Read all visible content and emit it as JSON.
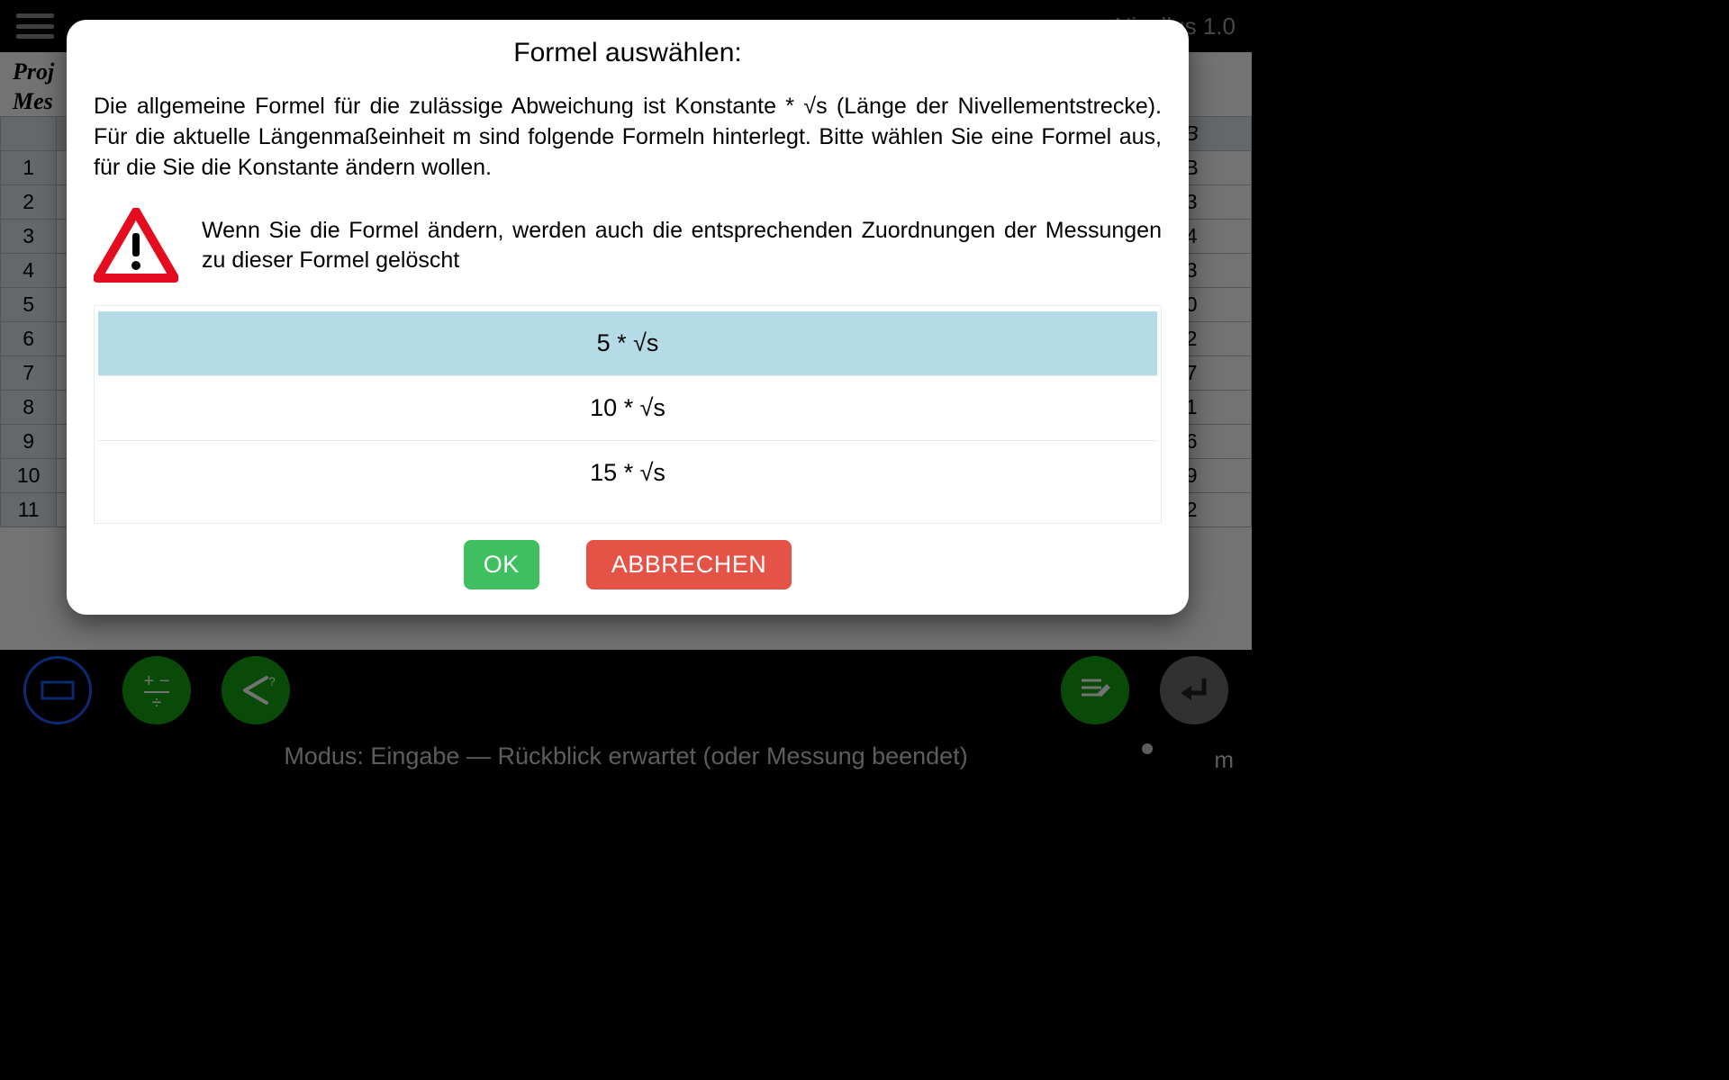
{
  "app": {
    "title": "Nivellus 1.0",
    "project_label_line1": "Proj",
    "project_label_line2": "Mes",
    "status_text": "Modus: Eingabe — Rückblick erwartet (oder Messung beendet)",
    "unit": "m",
    "col_header_last": "B",
    "cell_r1_last": "B",
    "right_col_values": [
      "3",
      "4",
      "3",
      "0",
      "2",
      "7",
      "1",
      "6",
      "9",
      "2"
    ],
    "row_numbers": [
      "1",
      "2",
      "3",
      "4",
      "5",
      "6",
      "7",
      "8",
      "9",
      "10",
      "11"
    ]
  },
  "dialog": {
    "title": "Formel auswählen:",
    "description": "Die allgemeine Formel für die zulässige Abweichung ist Konstante * √s (Länge der Nivellementstrecke). Für die aktuelle Längenmaßeinheit m sind folgende Formeln hinterlegt. Bitte wählen Sie eine Formel aus, für die Sie die Konstante ändern wollen.",
    "warning_text": "Wenn Sie die Formel ändern, werden auch die entsprechenden Zuordnungen der Messungen zu dieser Formel gelöscht",
    "options": [
      "5 * √s",
      "10 * √s",
      "15 * √s"
    ],
    "selected_index": 0,
    "ok_label": "OK",
    "cancel_label": "ABBRECHEN"
  }
}
